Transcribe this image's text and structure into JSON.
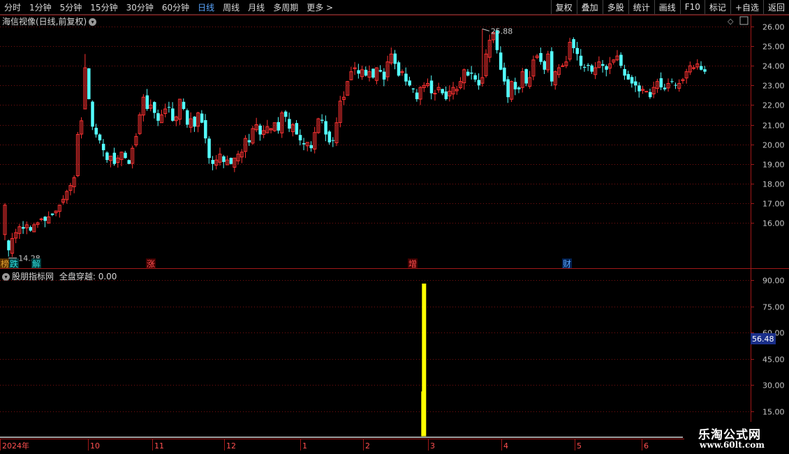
{
  "toolbar": {
    "periods": [
      {
        "label": "分时",
        "active": false
      },
      {
        "label": "1分钟",
        "active": false
      },
      {
        "label": "5分钟",
        "active": false
      },
      {
        "label": "15分钟",
        "active": false
      },
      {
        "label": "30分钟",
        "active": false
      },
      {
        "label": "60分钟",
        "active": false
      },
      {
        "label": "日线",
        "active": true
      },
      {
        "label": "周线",
        "active": false
      },
      {
        "label": "月线",
        "active": false
      },
      {
        "label": "多周期",
        "active": false
      },
      {
        "label": "更多 >",
        "active": false
      }
    ],
    "actions": [
      "复权",
      "叠加",
      "多股",
      "统计",
      "画线",
      "F10",
      "标记",
      "+自选",
      "返回"
    ]
  },
  "main_panel": {
    "title": "海信视像(日线,前复权)",
    "high_label": "25.88",
    "low_label": "14.28",
    "markers": [
      {
        "text": "榜",
        "color": "#e0a030",
        "bg": "#5a3000"
      },
      {
        "text": "跌",
        "color": "#30e0e0",
        "bg": "#003a3a"
      },
      {
        "text": "解",
        "color": "#30e0e0",
        "bg": "#003a3a"
      },
      {
        "text": "涨",
        "color": "#ff5050",
        "bg": "#400000"
      },
      {
        "text": "增",
        "color": "#ff5050",
        "bg": "#400000"
      },
      {
        "text": "财",
        "color": "#5aa6ff",
        "bg": "#002050"
      }
    ]
  },
  "indicator_panel": {
    "title": "股朋指标网",
    "value_text": "全盘穿越: 0.00",
    "current_label": "56.48"
  },
  "chart_data": [
    {
      "type": "candlestick",
      "title": "海信视像(日线,前复权)",
      "y_ticks": [
        "26.00",
        "25.00",
        "24.00",
        "23.00",
        "22.00",
        "21.00",
        "20.00",
        "19.00",
        "18.00",
        "17.00",
        "16.00"
      ],
      "ylim": [
        14.0,
        26.5
      ],
      "max": 25.88,
      "min": 14.28,
      "grid": true,
      "colors": {
        "up": "#ff3232",
        "down": "#54ffff"
      },
      "closes": [
        16.9,
        14.6,
        15.2,
        15.5,
        15.8,
        15.7,
        15.9,
        15.6,
        15.9,
        16.0,
        16.2,
        16.1,
        16.3,
        16.4,
        16.6,
        16.9,
        17.2,
        17.6,
        17.9,
        18.3,
        20.5,
        21.2,
        23.9,
        22.3,
        20.9,
        20.5,
        20.2,
        19.7,
        19.2,
        19.4,
        19.0,
        19.3,
        19.6,
        19.3,
        19.0,
        19.8,
        20.4,
        21.5,
        22.4,
        21.8,
        22.0,
        21.6,
        21.2,
        21.5,
        21.8,
        21.9,
        21.2,
        21.4,
        22.3,
        21.8,
        21.0,
        21.3,
        20.9,
        21.6,
        21.1,
        20.3,
        19.3,
        19.0,
        19.2,
        19.5,
        19.1,
        19.2,
        19.0,
        19.3,
        19.5,
        19.6,
        20.3,
        20.1,
        20.8,
        21.0,
        20.5,
        20.7,
        20.9,
        20.8,
        21.1,
        20.7,
        21.6,
        21.4,
        20.8,
        21.0,
        20.5,
        20.2,
        20.0,
        20.1,
        19.8,
        20.6,
        21.3,
        21.2,
        20.5,
        20.1,
        20.2,
        21.1,
        22.2,
        22.4,
        23.2,
        23.7,
        23.9,
        23.6,
        23.8,
        23.5,
        23.7,
        23.4,
        23.9,
        23.7,
        23.3,
        24.2,
        24.6,
        24.1,
        23.5,
        23.7,
        23.2,
        23.0,
        22.8,
        22.3,
        22.9,
        23.0,
        23.1,
        22.6,
        22.6,
        22.9,
        22.6,
        22.3,
        22.7,
        22.9,
        22.8,
        23.2,
        23.8,
        23.5,
        23.6,
        23.3,
        23.0,
        23.4,
        24.6,
        25.3,
        25.7,
        24.8,
        23.8,
        23.2,
        22.4,
        23.2,
        22.8,
        22.8,
        23.7,
        23.1,
        23.4,
        24.3,
        24.5,
        24.2,
        23.8,
        24.6,
        23.2,
        23.7,
        23.9,
        24.0,
        24.2,
        25.2,
        24.9,
        24.6,
        24.0,
        23.9,
        24.0,
        23.7,
        23.9,
        24.2,
        24.0,
        23.8,
        24.1,
        24.3,
        24.5,
        24.0,
        23.5,
        23.3,
        23.1,
        23.0,
        22.7,
        22.8,
        22.7,
        22.4,
        22.9,
        23.2,
        22.9,
        22.8,
        23.1,
        23.2,
        23.0,
        23.1,
        23.3,
        23.7,
        24.0,
        23.9,
        24.1,
        23.8,
        23.7
      ]
    },
    {
      "type": "bar",
      "title": "股朋指标网",
      "series": [
        {
          "name": "全盘穿越",
          "value": 0.0
        }
      ],
      "y_ticks": [
        "90.00",
        "75.00",
        "60.00",
        "45.00",
        "30.00",
        "15.00"
      ],
      "ylim": [
        0,
        95
      ],
      "spike": {
        "candle_index": 115,
        "value": 88.0
      },
      "colors": {
        "bar": "#ffff00"
      }
    }
  ],
  "time_axis": {
    "labels": [
      "2024年",
      "10",
      "11",
      "12",
      "1",
      "2",
      "3",
      "4",
      "5",
      "6"
    ]
  },
  "watermark": {
    "line1": "乐淘公式网",
    "line2": "www.60lt.com"
  }
}
